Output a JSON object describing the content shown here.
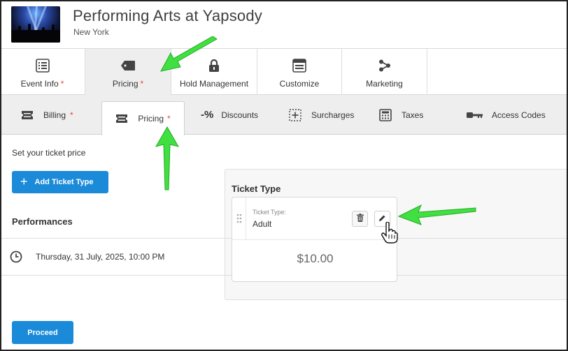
{
  "event": {
    "title": "Performing Arts at Yapsody",
    "location": "New York"
  },
  "main_tabs": [
    {
      "label": "Event Info",
      "required": "*",
      "icon": "list-icon"
    },
    {
      "label": "Pricing",
      "required": "*",
      "icon": "price-tag-icon",
      "active": true
    },
    {
      "label": "Hold Management",
      "required": "",
      "icon": "lock-icon"
    },
    {
      "label": "Customize",
      "required": "",
      "icon": "browser-window-icon"
    },
    {
      "label": "Marketing",
      "required": "",
      "icon": "share-icon"
    }
  ],
  "sub_tabs": [
    {
      "label": "Billing",
      "required": "*",
      "icon": "ticket-icon"
    },
    {
      "label": "Pricing",
      "required": "*",
      "icon": "ticket-icon",
      "active": true
    },
    {
      "label": "Discounts",
      "required": "",
      "icon": "percent-icon"
    },
    {
      "label": "Surcharges",
      "required": "",
      "icon": "plus-box-icon"
    },
    {
      "label": "Taxes",
      "required": "",
      "icon": "calculator-icon"
    },
    {
      "label": "Access Codes",
      "required": "",
      "icon": "key-icon"
    }
  ],
  "content": {
    "intro": "Set your ticket price",
    "add_button": "Add Ticket Type",
    "add_button_icon": "+",
    "performances_title": "Performances",
    "performance_date": "Thursday, 31 July, 2025, 10:00 PM",
    "proceed_button": "Proceed"
  },
  "ticket_panel": {
    "title": "Ticket Type",
    "type_label": "Ticket Type:",
    "type_value": "Adult",
    "price": "$10.00"
  },
  "colors": {
    "primary": "#1b8bd9",
    "required": "#e04848",
    "annotation_arrow": "#3fe03f"
  }
}
